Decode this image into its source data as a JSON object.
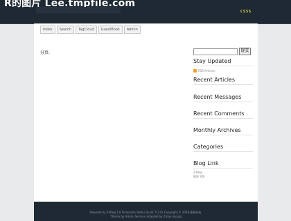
{
  "header": {
    "site_title": "R的图片 Lee.tmpfile.com",
    "logo_mark": "CSSS"
  },
  "nav": {
    "items": [
      {
        "label": "Index"
      },
      {
        "label": "Search"
      },
      {
        "label": "TagCloud"
      },
      {
        "label": "GuestBook"
      },
      {
        "label": "Admin"
      }
    ]
  },
  "main": {
    "page_label": "分页:"
  },
  "search": {
    "placeholder": "",
    "button_label": "提交"
  },
  "sidebar": {
    "sections": [
      {
        "title": "Stay Updated"
      },
      {
        "title": "Recent Articles"
      },
      {
        "title": "Recent Messages"
      },
      {
        "title": "Recent Comments"
      },
      {
        "title": "Monthly Archives"
      },
      {
        "title": "Categories"
      },
      {
        "title": "Blog Link"
      }
    ],
    "rss_label": "RSS Articles",
    "blog_links": [
      "Z-Blog",
      "疯狂飞翔"
    ]
  },
  "footer": {
    "line1": "Powered by Z-Blog 1.8 Terminator Beta2 Build 71225 Copyright © 2008 版权所有.",
    "line2": "Theme by Adrian Serrano Adapted by Zmax Huang"
  }
}
